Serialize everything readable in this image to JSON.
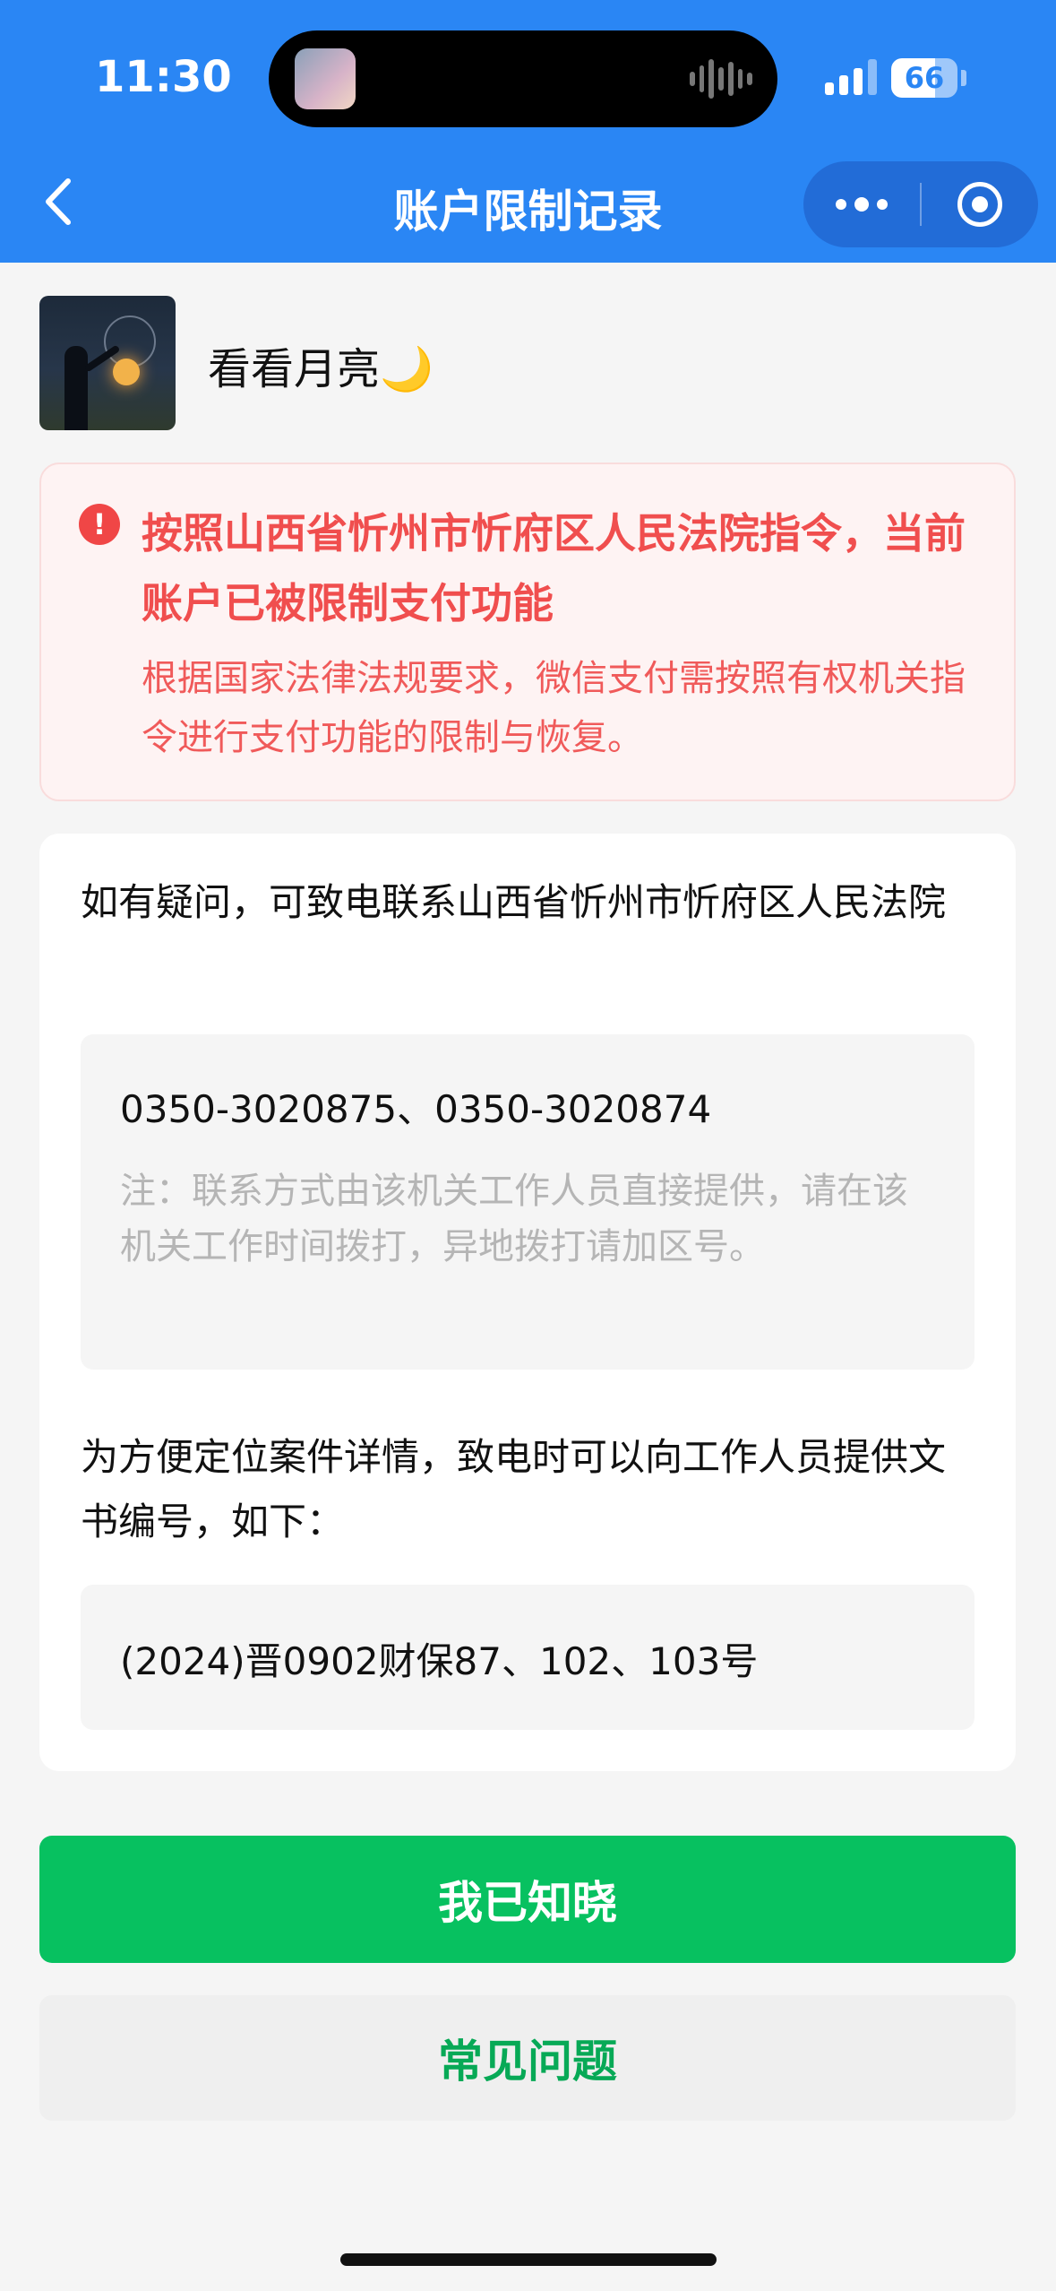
{
  "status_bar": {
    "time": "11:30",
    "battery": "66",
    "signal_bars_full": 3,
    "signal_bars_total": 4
  },
  "nav": {
    "title": "账户限制记录",
    "back_icon": "chevron-left-icon",
    "more_icon": "more-dots-icon",
    "close_icon": "target-circle-icon"
  },
  "user": {
    "name": "看看月亮🌙"
  },
  "alert": {
    "icon": "exclamation-circle-icon",
    "title": "按照山西省忻州市忻府区人民法院指令，当前账户已被限制支付功能",
    "description": "根据国家法律法规要求，微信支付需按照有权机关指令进行支付功能的限制与恢复。"
  },
  "info": {
    "contact_text": "如有疑问，可致电联系山西省忻州市忻府区人民法院",
    "phone_numbers": "0350-3020875、0350-3020874",
    "note": "注：联系方式由该机关工作人员直接提供，请在该机关工作时间拨打，异地拨打请加区号。",
    "doc_text": "为方便定位案件详情，致电时可以向工作人员提供文书编号，如下：",
    "doc_number": "(2024)晋0902财保87、102、103号"
  },
  "buttons": {
    "acknowledge": "我已知晓",
    "faq": "常见问题"
  },
  "colors": {
    "header_blue": "#2a86f4",
    "alert_red": "#f04e4e",
    "wechat_green": "#07c160"
  }
}
